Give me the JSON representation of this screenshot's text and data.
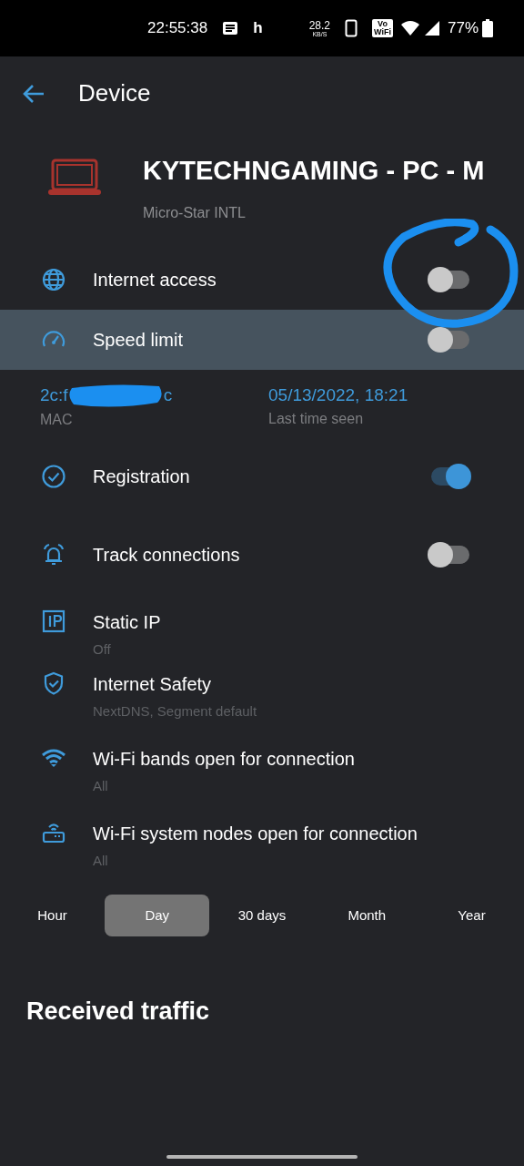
{
  "status_bar": {
    "time": "22:55:38",
    "notification_letter": "h",
    "speed_value": "28.2",
    "speed_unit": "KB/S",
    "vowifi_top": "Vo",
    "vowifi_bottom": "WiFi",
    "battery": "77%"
  },
  "app_bar": {
    "title": "Device"
  },
  "device": {
    "name": "KYTECHNGAMING - PC - M",
    "vendor": "Micro-Star INTL"
  },
  "settings": [
    {
      "kind": "toggle",
      "label": "Internet access",
      "on": false,
      "highlighted": false
    },
    {
      "kind": "toggle",
      "label": "Speed limit",
      "on": false,
      "highlighted": true
    },
    {
      "kind": "info",
      "mac_start": "2c:f",
      "mac_end": "c",
      "mac_label": "MAC",
      "last_seen": "05/13/2022, 18:21",
      "last_seen_label": "Last time seen"
    },
    {
      "kind": "toggle",
      "label": "Registration",
      "on": true,
      "highlighted": false
    },
    {
      "kind": "toggle",
      "label": "Track connections",
      "on": false,
      "highlighted": false
    },
    {
      "kind": "value",
      "label": "Static IP",
      "value": "Off"
    },
    {
      "kind": "value",
      "label": "Internet Safety",
      "value": "NextDNS, Segment default"
    },
    {
      "kind": "value",
      "label": "Wi-Fi bands open for connection",
      "value": "All"
    },
    {
      "kind": "value",
      "label": "Wi-Fi system nodes open for connection",
      "value": "All"
    }
  ],
  "period_tabs": [
    {
      "label": "Hour",
      "selected": false
    },
    {
      "label": "Day",
      "selected": true
    },
    {
      "label": "30 days",
      "selected": false
    },
    {
      "label": "Month",
      "selected": false
    },
    {
      "label": "Year",
      "selected": false
    }
  ],
  "section_title": "Received traffic",
  "annotations": [
    {
      "kind": "circle"
    }
  ]
}
